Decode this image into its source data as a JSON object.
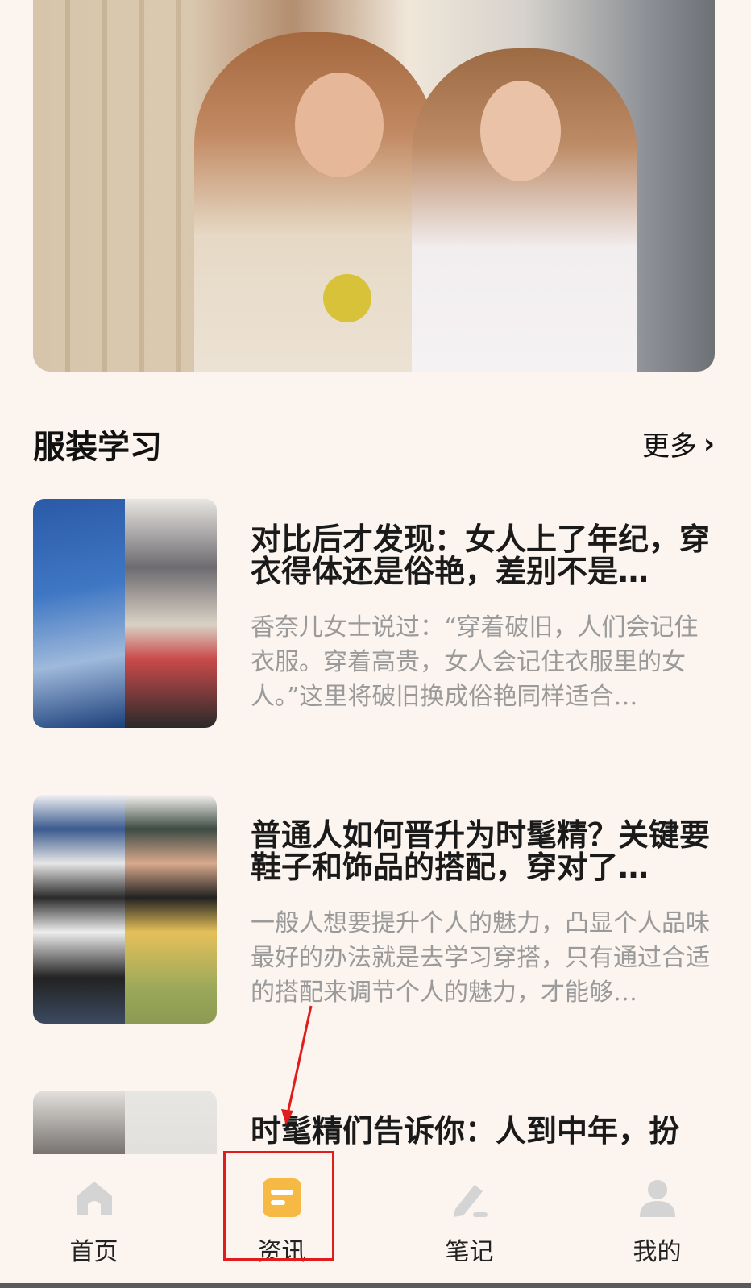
{
  "section": {
    "title": "服装学习",
    "more_label": "更多"
  },
  "articles": [
    {
      "title": "对比后才发现：女人上了年纪，穿衣得体还是俗艳，差别不是…",
      "desc": "香奈儿女士说过：“穿着破旧，人们会记住衣服。穿着高贵，女人会记住衣服里的女人。”这里将破旧换成俗艳同样适合…"
    },
    {
      "title": "普通人如何晋升为时髦精？关键要鞋子和饰品的搭配，穿对了…",
      "desc": "一般人想要提升个人的魅力，凸显个人品味最好的办法就是去学习穿搭，只有通过合适的搭配来调节个人的魅力，才能够…"
    },
    {
      "title": "时髦精们告诉你：人到中年，扮",
      "desc": ""
    }
  ],
  "tabs": [
    {
      "label": "首页",
      "icon": "home-icon"
    },
    {
      "label": "资讯",
      "icon": "news-icon"
    },
    {
      "label": "笔记",
      "icon": "edit-icon"
    },
    {
      "label": "我的",
      "icon": "user-icon"
    }
  ],
  "colors": {
    "active_tab": "#f5b944",
    "inactive_icon": "#d4d4d4",
    "annotation": "#e01c1c"
  }
}
